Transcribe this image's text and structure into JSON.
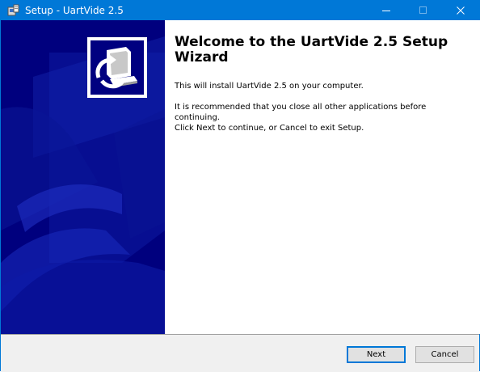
{
  "window": {
    "title": "Setup - UartVide 2.5",
    "accent_color": "#0078d7",
    "controls": [
      "minimize-icon",
      "maximize-icon",
      "close-icon"
    ]
  },
  "banner": {
    "background_color": "#000080",
    "logo_icon": "computer-installer-icon"
  },
  "content": {
    "heading": "Welcome to the UartVide 2.5 Setup Wizard",
    "paragraphs": [
      "This will install UartVide 2.5 on your computer.",
      "It is recommended that you close all other applications before continuing.",
      "Click Next to continue, or Cancel to exit Setup."
    ]
  },
  "buttons": {
    "next_label": "Next",
    "cancel_label": "Cancel"
  }
}
